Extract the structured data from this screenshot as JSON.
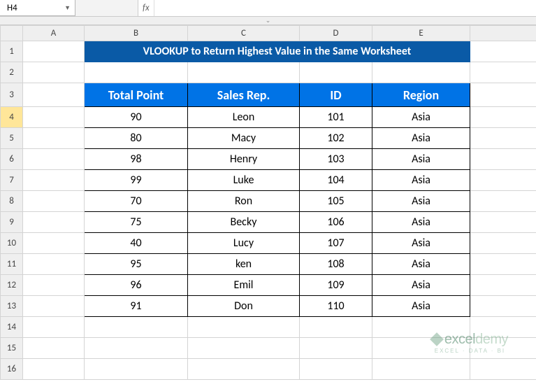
{
  "namebox": {
    "value": "H4",
    "dropdown_glyph": "▼"
  },
  "fx_label": "fx",
  "formula": "",
  "collapse_glyph": "⌄",
  "columns": [
    "A",
    "B",
    "C",
    "D",
    "E"
  ],
  "row_numbers": [
    1,
    2,
    3,
    4,
    5,
    6,
    7,
    8,
    9,
    10,
    11,
    12,
    13,
    14,
    15,
    16
  ],
  "selected_row": 4,
  "title": "VLOOKUP to Return Highest Value in the Same Worksheet",
  "headers": {
    "total_point": "Total Point",
    "sales_rep": "Sales Rep.",
    "id": "ID",
    "region": "Region"
  },
  "rows": [
    {
      "total_point": "90",
      "sales_rep": "Leon",
      "id": "101",
      "region": "Asia"
    },
    {
      "total_point": "80",
      "sales_rep": "Macy",
      "id": "102",
      "region": "Asia"
    },
    {
      "total_point": "98",
      "sales_rep": "Henry",
      "id": "103",
      "region": "Asia"
    },
    {
      "total_point": "99",
      "sales_rep": "Luke",
      "id": "104",
      "region": "Asia"
    },
    {
      "total_point": "70",
      "sales_rep": "Ron",
      "id": "105",
      "region": "Asia"
    },
    {
      "total_point": "75",
      "sales_rep": "Becky",
      "id": "106",
      "region": "Asia"
    },
    {
      "total_point": "40",
      "sales_rep": "Lucy",
      "id": "107",
      "region": "Asia"
    },
    {
      "total_point": "95",
      "sales_rep": "ken",
      "id": "108",
      "region": "Asia"
    },
    {
      "total_point": "96",
      "sales_rep": "Emil",
      "id": "109",
      "region": "Asia"
    },
    {
      "total_point": "91",
      "sales_rep": "Don",
      "id": "110",
      "region": "Asia"
    }
  ],
  "watermark": {
    "brand_a": "excel",
    "brand_b": "demy",
    "tagline": "EXCEL · DATA · BI"
  }
}
